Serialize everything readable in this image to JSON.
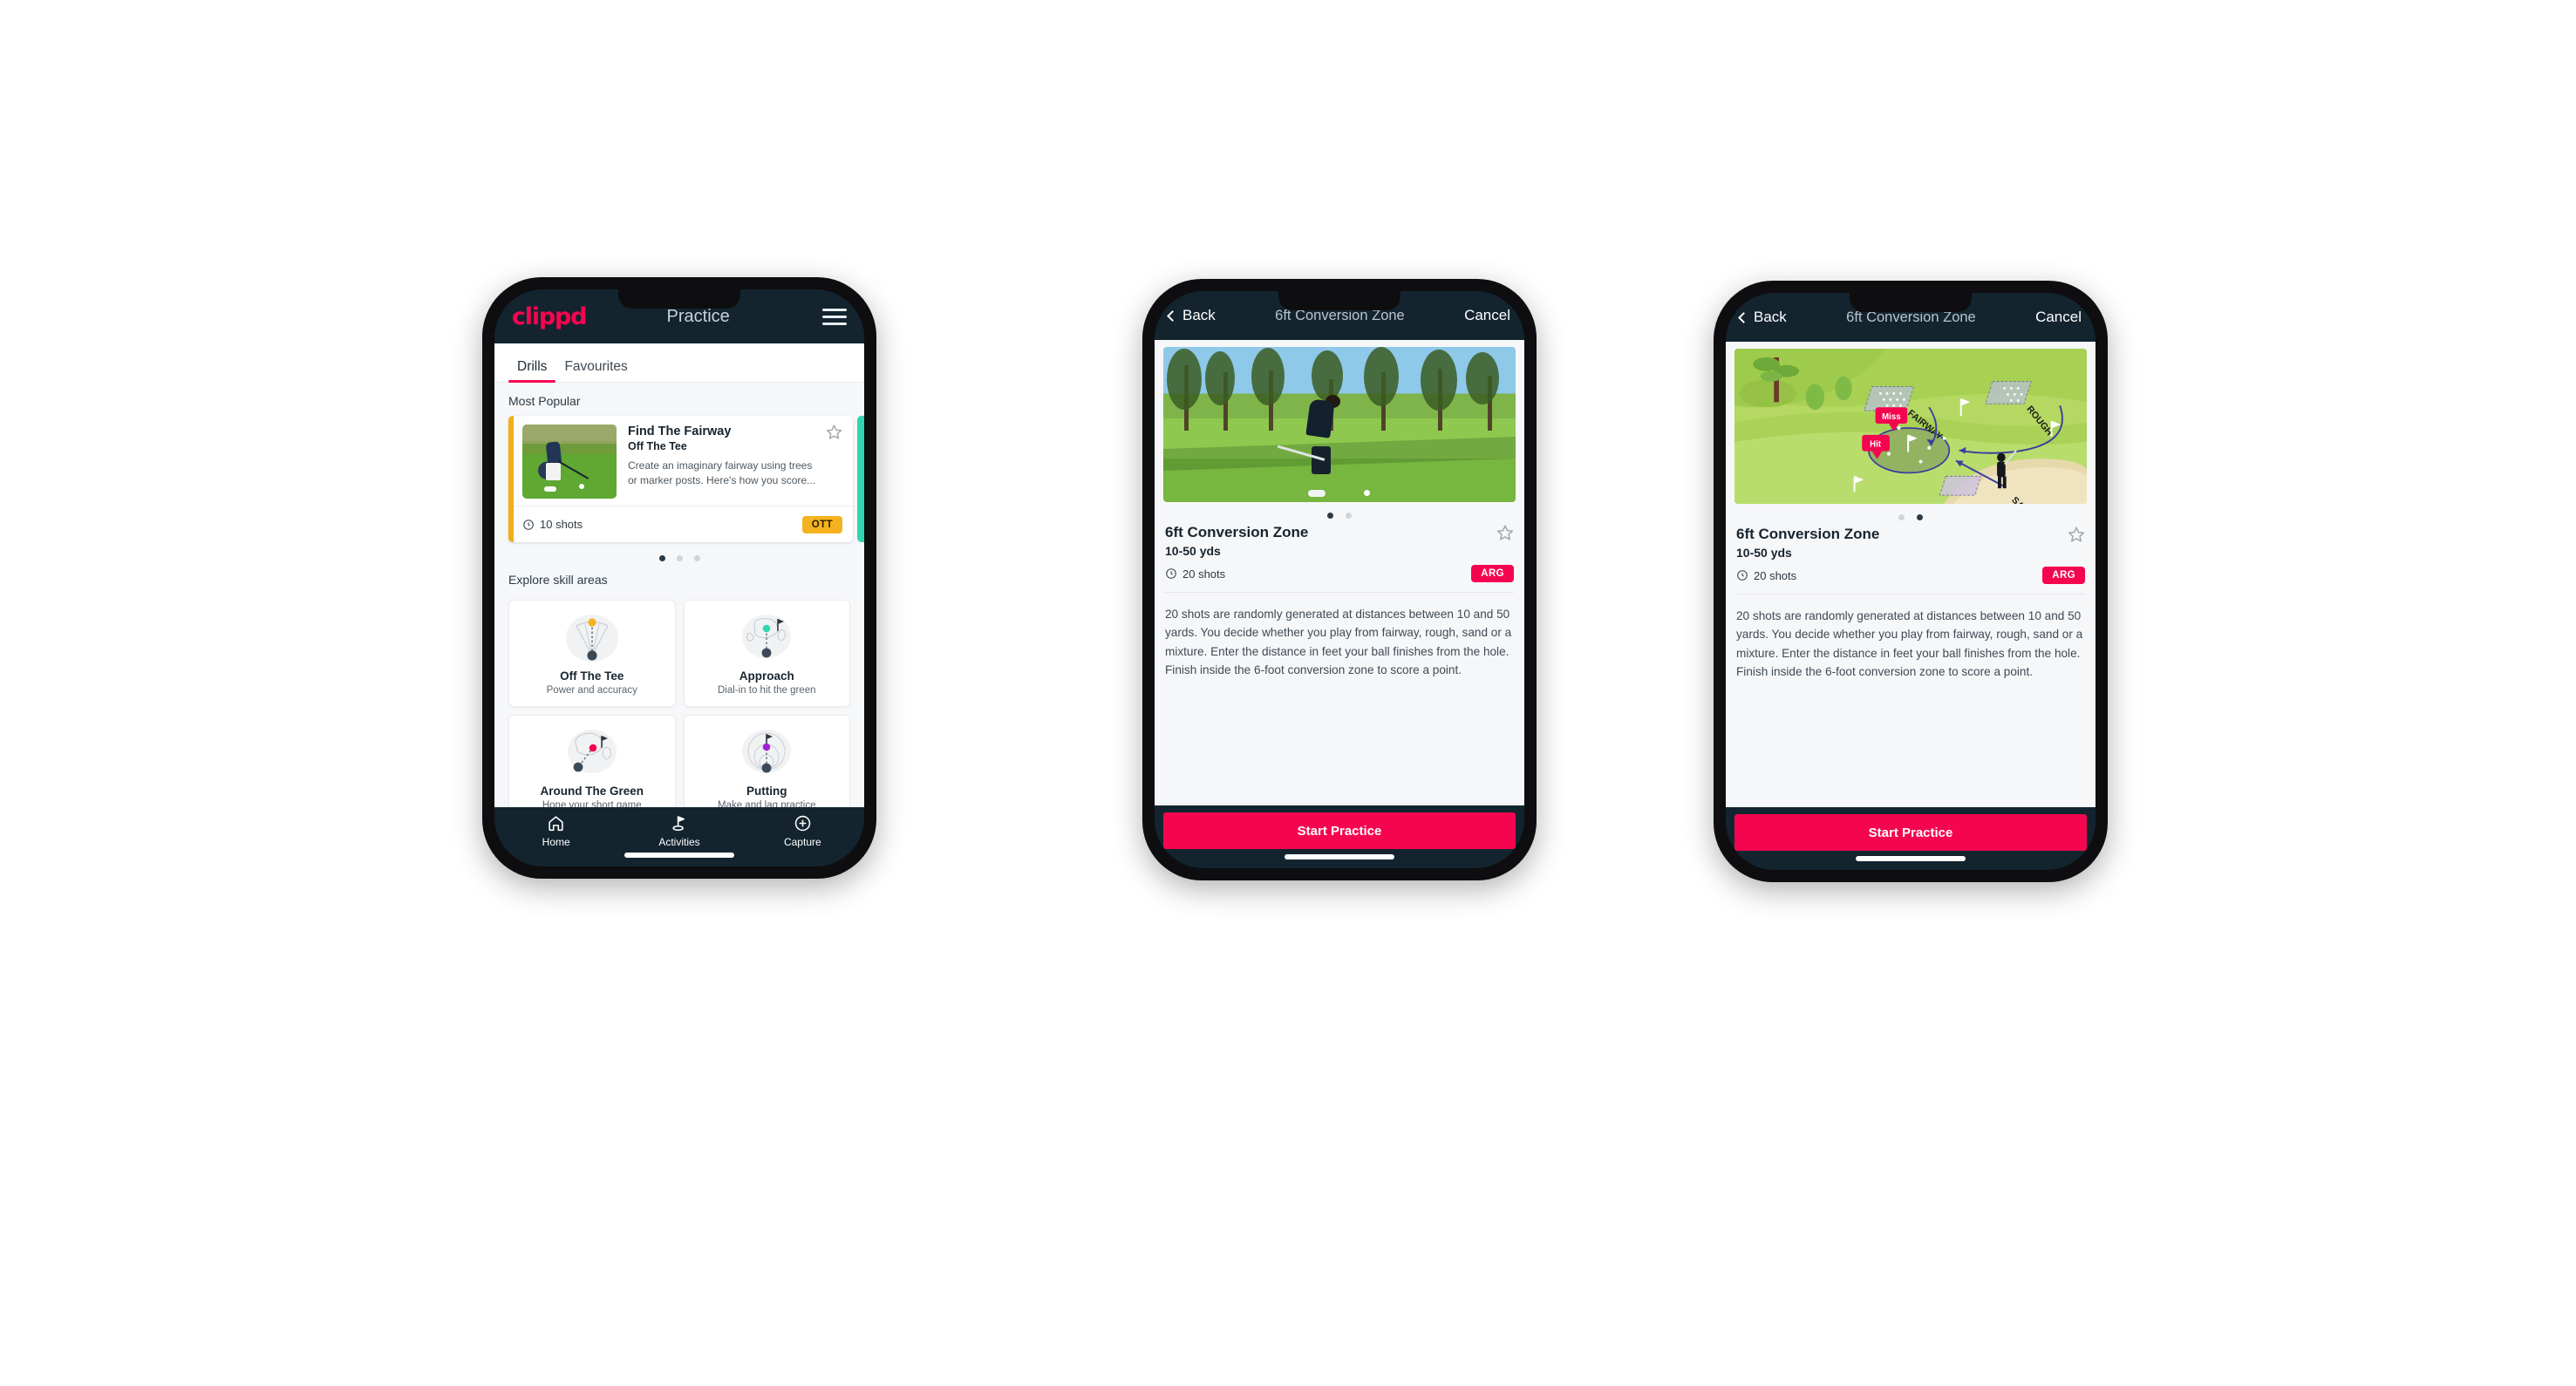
{
  "brand": {
    "logo_text": "clippd",
    "accent_pink": "#f5054f",
    "dark_navy": "#13242f",
    "amber": "#f5b220",
    "teal": "#2fd6b0"
  },
  "phone1": {
    "header": {
      "logo": "clippd",
      "title": "Practice",
      "menu_icon": "hamburger-menu-icon"
    },
    "tabs": [
      {
        "label": "Drills",
        "active": true
      },
      {
        "label": "Favourites",
        "active": false
      }
    ],
    "sections": {
      "most_popular_label": "Most Popular",
      "explore_label": "Explore skill areas"
    },
    "featured_drill": {
      "name": "Find The Fairway",
      "category": "Off The Tee",
      "description": "Create an imaginary fairway using trees or marker posts. Here's how you score...",
      "shots": "10 shots",
      "badge": "OTT",
      "favourite_icon": "star-outline-icon"
    },
    "carousel_dots": {
      "count": 3,
      "active_index": 0
    },
    "skill_areas": [
      {
        "name": "Off The Tee",
        "desc": "Power and accuracy",
        "icon": "dispersion-cone-icon",
        "accent": "#f5b220"
      },
      {
        "name": "Approach",
        "desc": "Dial-in to hit the green",
        "icon": "green-approach-icon",
        "accent": "#2fd6b0"
      },
      {
        "name": "Around The Green",
        "desc": "Hone your short game",
        "icon": "chip-to-green-icon",
        "accent": "#f5054f"
      },
      {
        "name": "Putting",
        "desc": "Make and lag practice",
        "icon": "putting-rings-icon",
        "accent": "#a420d8"
      }
    ],
    "bottom_nav": [
      {
        "label": "Home",
        "icon": "home-icon",
        "active": false
      },
      {
        "label": "Activities",
        "icon": "golf-flag-icon",
        "active": true
      },
      {
        "label": "Capture",
        "icon": "plus-circle-icon",
        "active": false
      }
    ]
  },
  "detail": {
    "header": {
      "back": "Back",
      "title": "6ft Conversion Zone",
      "cancel": "Cancel",
      "back_icon": "chevron-left-icon"
    },
    "drill": {
      "name": "6ft Conversion Zone",
      "yards": "10-50 yds",
      "shots": "20 shots",
      "badge": "ARG",
      "favourite_icon": "star-outline-icon",
      "description": "20 shots are randomly generated at distances between 10 and 50 yards. You decide whether you play from fairway, rough, sand or a mixture. Enter the distance in feet your ball finishes from the hole. Finish inside the 6-foot conversion zone to score a point."
    },
    "cta": "Start Practice",
    "media_dots": {
      "count": 2
    },
    "phone2_active_dot": 0,
    "phone3_active_dot": 1
  },
  "illustration": {
    "labels": {
      "fairway": "FAIRWAY",
      "rough": "ROUGH",
      "sand": "SAND"
    },
    "markers": {
      "miss": "Miss",
      "hit": "Hit"
    }
  }
}
